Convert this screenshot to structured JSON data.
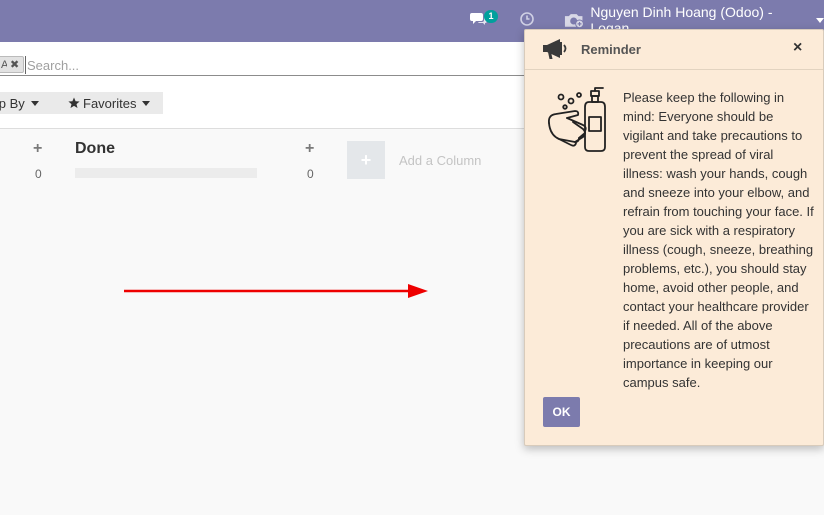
{
  "navbar": {
    "chat_icon": "chat-bubbles-icon",
    "chat_count": "1",
    "activity_icon": "clock-icon",
    "user_icon": "camera-avatar-icon",
    "user_name": "Nguyen Dinh Hoang (Odoo) - Logan"
  },
  "search": {
    "facet_value": "A",
    "facet_close": "✖",
    "placeholder": "Search..."
  },
  "filters": {
    "group_by_label": "roup By",
    "favorites_label": "Favorites",
    "favorites_icon": "star-icon"
  },
  "kanban": {
    "columns": [
      {
        "title": "",
        "quick_add": "+",
        "count": "0"
      },
      {
        "title": "Done",
        "quick_add": "+",
        "count": "0"
      }
    ],
    "add_column_icon": "+",
    "add_column_label": "Add a Column"
  },
  "reminder": {
    "header_icon": "megaphone-icon",
    "title": "Reminder",
    "close": "×",
    "illustration": "washing-hands-soap-icon",
    "message": "Please keep the following in mind: Everyone should be vigilant and take precautions to prevent the spread of viral illness: wash your hands, cough and sneeze into your elbow, and refrain from touching your face. If you are sick with a respiratory illness (cough, sneeze, breathing problems, etc.), you should stay home, avoid other people, and contact your healthcare provider if needed. All of the above precautions are of utmost importance in keeping our campus safe.",
    "ok_label": "OK"
  },
  "colors": {
    "navbar": "#7c7bad",
    "badge": "#00a09d",
    "popup_bg": "#fcebd8",
    "arrow": "#ee0000"
  }
}
